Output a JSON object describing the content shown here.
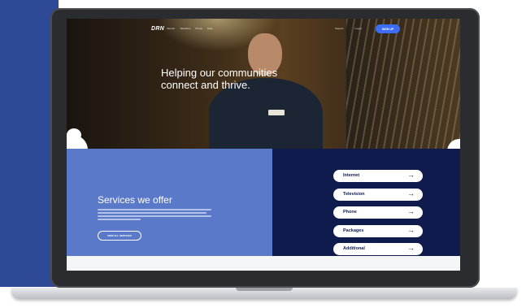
{
  "nav": {
    "logo": "DRN",
    "links": [
      "Internet",
      "Television",
      "Phone",
      "Help"
    ],
    "support": "Support",
    "login": "Log In",
    "signup": "SIGN UP"
  },
  "hero": {
    "title": "Helping our communities connect and thrive."
  },
  "services": {
    "title": "Services we offer",
    "cta": "VIEW ALL SERVICES",
    "items": [
      {
        "label": "Internet"
      },
      {
        "label": "Television"
      },
      {
        "label": "Phone"
      },
      {
        "label": "Packages"
      },
      {
        "label": "Additional"
      }
    ]
  },
  "colors": {
    "side_panel": "#2e4a96",
    "services_blue": "#5b79c9",
    "services_navy": "#0f1b4d",
    "accent": "#3d6df2"
  }
}
